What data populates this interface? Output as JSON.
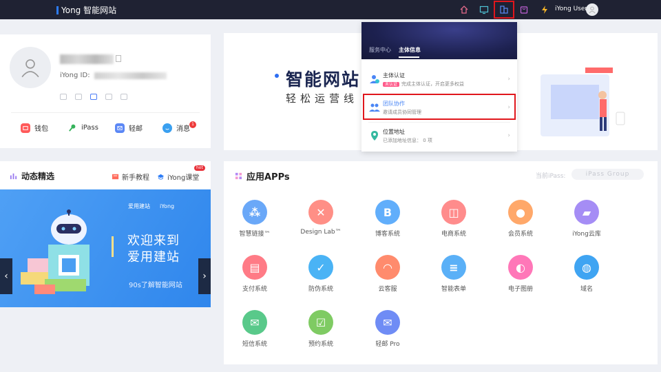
{
  "topbar": {
    "brand_i": "i",
    "brand_name": "Yong 智能网站",
    "user_name": "iYong User"
  },
  "profile": {
    "id_label": "iYong ID:",
    "quick": [
      {
        "label": "钱包",
        "icon": "wallet-icon",
        "color": "#ff5a5a"
      },
      {
        "label": "iPass",
        "icon": "key-icon",
        "color": "#35b35a"
      },
      {
        "label": "轻邮",
        "icon": "mail-icon",
        "color": "#5b87f5"
      },
      {
        "label": "消息",
        "icon": "message-icon",
        "color": "#3aa0f0"
      }
    ],
    "message_badge": "1"
  },
  "dynamic": {
    "title": "动态精选",
    "tutorial": "新手教程",
    "course": "iYong课堂",
    "hot": "hot",
    "banner_logo1": "爱用建站",
    "banner_logo2": "iYong",
    "banner_title_1": "欢迎来到",
    "banner_title_2": "爱用建站",
    "banner_sub": "90s了解智能网站"
  },
  "hero": {
    "title": "智能网站",
    "subtitle": "轻松运营线"
  },
  "dropdown": {
    "tabs": [
      "服务中心",
      "主体信息"
    ],
    "active_tab": 1,
    "items": [
      {
        "title": "主体认证",
        "tag": "未认证",
        "desc": "完成主体认证，开启更多权益"
      },
      {
        "title": "团队协作",
        "tag": "",
        "desc": "邀请成员协同管理"
      },
      {
        "title": "位置地址",
        "tag": "",
        "desc": "已添加地址信息： 0 项"
      }
    ]
  },
  "apps": {
    "title": "应用APPs",
    "ipass_label": "当前iPass:",
    "ipass_value": "iPass Group",
    "list": [
      {
        "label": "智慧链接™",
        "icon": "link-icon",
        "color": "#6aa8f8",
        "glyph": "⁂"
      },
      {
        "label": "Design Lab™",
        "icon": "design-icon",
        "color": "#ff8f86",
        "glyph": "✕"
      },
      {
        "label": "博客系统",
        "icon": "blog-icon",
        "color": "#61aefb",
        "glyph": "B"
      },
      {
        "label": "电商系统",
        "icon": "shop-icon",
        "color": "#ff8c8c",
        "glyph": "◫"
      },
      {
        "label": "会员系统",
        "icon": "member-icon",
        "color": "#ffa86a",
        "glyph": "●"
      },
      {
        "label": "iYong云库",
        "icon": "folder-icon",
        "color": "#a58df5",
        "glyph": "▰"
      },
      {
        "label": "支付系统",
        "icon": "pay-icon",
        "color": "#ff7b86",
        "glyph": "▤"
      },
      {
        "label": "防伪系统",
        "icon": "shield-icon",
        "color": "#4ab3f5",
        "glyph": "✓"
      },
      {
        "label": "云客服",
        "icon": "service-icon",
        "color": "#ff8b6d",
        "glyph": "◠"
      },
      {
        "label": "智能表单",
        "icon": "form-icon",
        "color": "#5ab0f7",
        "glyph": "≡"
      },
      {
        "label": "电子图册",
        "icon": "album-icon",
        "color": "#ff77b8",
        "glyph": "◐"
      },
      {
        "label": "域名",
        "icon": "www-icon",
        "color": "#3fa4f2",
        "glyph": "◍"
      },
      {
        "label": "短信系统",
        "icon": "sms-icon",
        "color": "#59c98a",
        "glyph": "✉"
      },
      {
        "label": "预约系统",
        "icon": "calendar-icon",
        "color": "#7fcb63",
        "glyph": "☑"
      },
      {
        "label": "轻邮 Pro",
        "icon": "mail-pro-icon",
        "color": "#6f8cf5",
        "glyph": "✉"
      }
    ]
  }
}
